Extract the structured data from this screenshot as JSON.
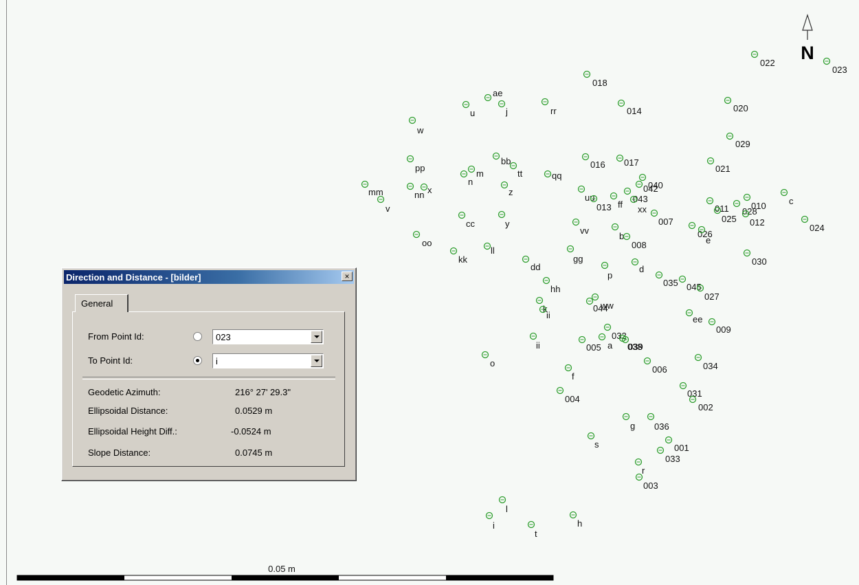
{
  "map": {
    "north_label": "N",
    "scale_label": "0.05 m",
    "point_color": "#2e9e2e",
    "points": [
      {
        "label": "022"
      },
      {
        "label": "023"
      },
      {
        "label": "018"
      },
      {
        "label": "ae"
      },
      {
        "label": "j"
      },
      {
        "label": "u"
      },
      {
        "label": "rr"
      },
      {
        "label": "014"
      },
      {
        "label": "020"
      },
      {
        "label": "w"
      },
      {
        "label": "029"
      },
      {
        "label": "pp"
      },
      {
        "label": "bb"
      },
      {
        "label": "tt"
      },
      {
        "label": "016"
      },
      {
        "label": "017"
      },
      {
        "label": "021"
      },
      {
        "label": "n"
      },
      {
        "label": "m"
      },
      {
        "label": "qq"
      },
      {
        "label": "040"
      },
      {
        "label": "042"
      },
      {
        "label": "mm"
      },
      {
        "label": "nn"
      },
      {
        "label": "x"
      },
      {
        "label": "z"
      },
      {
        "label": "v"
      },
      {
        "label": "uu"
      },
      {
        "label": "013"
      },
      {
        "label": "ff"
      },
      {
        "label": "043"
      },
      {
        "label": "xx"
      },
      {
        "label": "011"
      },
      {
        "label": "028"
      },
      {
        "label": "010"
      },
      {
        "label": "c"
      },
      {
        "label": "cc"
      },
      {
        "label": "y"
      },
      {
        "label": "007"
      },
      {
        "label": "025"
      },
      {
        "label": "012"
      },
      {
        "label": "026"
      },
      {
        "label": "e"
      },
      {
        "label": "024"
      },
      {
        "label": "vv"
      },
      {
        "label": "b"
      },
      {
        "label": "oo"
      },
      {
        "label": "008"
      },
      {
        "label": "kk"
      },
      {
        "label": "ll"
      },
      {
        "label": "gg"
      },
      {
        "label": "dd"
      },
      {
        "label": "030"
      },
      {
        "label": "d"
      },
      {
        "label": "p"
      },
      {
        "label": "035"
      },
      {
        "label": "045"
      },
      {
        "label": "027"
      },
      {
        "label": "hh"
      },
      {
        "label": "k"
      },
      {
        "label": "ii"
      },
      {
        "label": "ww"
      },
      {
        "label": "044"
      },
      {
        "label": "ee"
      },
      {
        "label": "009"
      },
      {
        "label": "032"
      },
      {
        "label": "ii"
      },
      {
        "label": "005"
      },
      {
        "label": "a"
      },
      {
        "label": "038"
      },
      {
        "label": "039"
      },
      {
        "label": "o"
      },
      {
        "label": "006"
      },
      {
        "label": "034"
      },
      {
        "label": "f"
      },
      {
        "label": "004"
      },
      {
        "label": "031"
      },
      {
        "label": "002"
      },
      {
        "label": "g"
      },
      {
        "label": "036"
      },
      {
        "label": "s"
      },
      {
        "label": "001"
      },
      {
        "label": "033"
      },
      {
        "label": "r"
      },
      {
        "label": "003"
      },
      {
        "label": "l"
      },
      {
        "label": "i"
      },
      {
        "label": "t"
      },
      {
        "label": "h"
      }
    ]
  },
  "dialog": {
    "title": "Direction and Distance - [bilder]",
    "close_glyph": "×",
    "tab_label": "General",
    "from_label": "From Point Id:",
    "from_value": "023",
    "to_label": "To Point Id:",
    "to_value": "i",
    "results": [
      {
        "label": "Geodetic Azimuth:",
        "value": "216° 27' 29.3\""
      },
      {
        "label": "Ellipsoidal Distance:",
        "value": "0.0529 m"
      },
      {
        "label": "Ellipsoidal Height Diff.:",
        "value": "-0.0524 m"
      },
      {
        "label": "Slope Distance:",
        "value": "0.0745 m"
      }
    ]
  }
}
